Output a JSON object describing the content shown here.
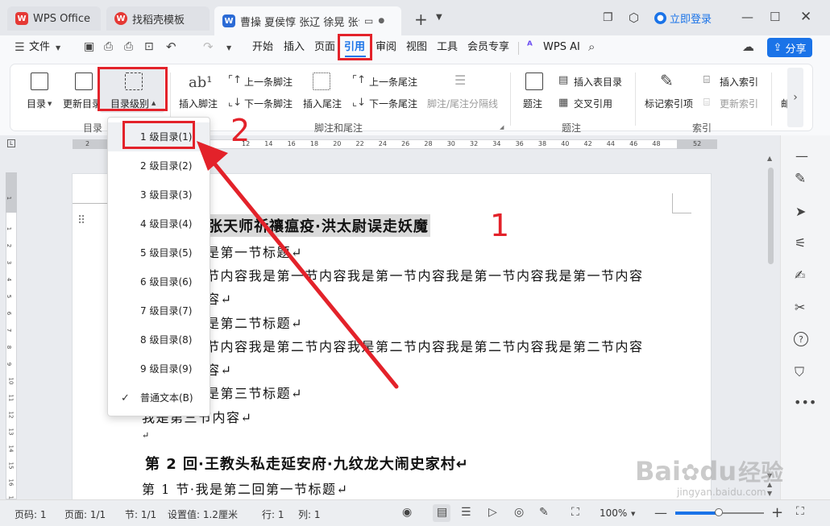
{
  "titlebar": {
    "tabs": [
      {
        "label": "WPS Office",
        "logo": "W"
      },
      {
        "label": "找稻壳模板",
        "logo": "W"
      },
      {
        "label": "曹操 夏侯惇 张辽 徐晃 张郃 于",
        "logo": "W"
      }
    ],
    "login": "立即登录"
  },
  "menubar": {
    "file": "文件",
    "items": [
      "开始",
      "插入",
      "页面",
      "引用",
      "审阅",
      "视图",
      "工具",
      "会员专享"
    ],
    "active": "引用",
    "wps_ai": "WPS AI",
    "share": "分享"
  },
  "ribbon": {
    "toc": "目录",
    "update_toc": "更新目录",
    "toc_level": "目录级别",
    "insert_footnote": "插入脚注",
    "prev_footnote": "上一条脚注",
    "next_footnote": "下一条脚注",
    "insert_endnote": "插入尾注",
    "prev_endnote": "上一条尾注",
    "next_endnote": "下一条尾注",
    "separator_line": "脚注/尾注分隔线",
    "caption": "题注",
    "insert_table_toc": "插入表目录",
    "cross_ref": "交叉引用",
    "mark_index": "标记索引项",
    "insert_index": "插入索引",
    "update_index": "更新索引",
    "more": "邮",
    "groups": {
      "toc": "目录",
      "notes": "脚注和尾注",
      "caption": "题注",
      "index": "索引"
    }
  },
  "ruler": {
    "top_ticks": [
      "2",
      "12",
      "14",
      "16",
      "18",
      "20",
      "22",
      "24",
      "26",
      "28",
      "30",
      "32",
      "34",
      "36",
      "38",
      "40",
      "42",
      "44",
      "46",
      "48",
      "52"
    ],
    "left_ticks": [
      "1",
      "1",
      "2",
      "3",
      "4",
      "5",
      "6",
      "7",
      "8",
      "9",
      "10",
      "11",
      "12",
      "13",
      "14",
      "15",
      "16",
      "17"
    ]
  },
  "document": {
    "lines": [
      {
        "text": "张天师祈禳瘟疫·洪太尉误走妖魔",
        "style": "heading"
      },
      {
        "text": "是第一节标题↵",
        "style": "body"
      },
      {
        "text": "节内容我是第一节内容我是第一节内容我是第一节内容我是第一节内容",
        "style": "body"
      },
      {
        "text": "容↵",
        "style": "body"
      },
      {
        "text": "是第二节标题↵",
        "style": "body"
      },
      {
        "text": "节内容我是第二节内容我是第二节内容我是第二节内容我是第二节内容",
        "style": "body"
      },
      {
        "text": "容↵",
        "style": "body"
      },
      {
        "text": "是第三节标题↵",
        "style": "body"
      },
      {
        "text": "我是第三节内容↵",
        "style": "body"
      },
      {
        "text": "↵",
        "style": "body"
      },
      {
        "text": "第 2 回·王教头私走延安府·九纹龙大闹史家村↵",
        "style": "heading"
      },
      {
        "text": "第 1 节·我是第二回第一节标题↵",
        "style": "body"
      }
    ]
  },
  "dropdown": {
    "items": [
      "1 级目录(1)",
      "2 级目录(2)",
      "3 级目录(3)",
      "4 级目录(4)",
      "5 级目录(5)",
      "6 级目录(6)",
      "7 级目录(7)",
      "8 级目录(8)",
      "9 级目录(9)",
      "普通文本(B)"
    ],
    "checked_index": 9
  },
  "statusbar": {
    "page_no": "页码: 1",
    "pages": "页面: 1/1",
    "section": "节: 1/1",
    "setting": "设置值: 1.2厘米",
    "row": "行: 1",
    "col": "列: 1",
    "zoom": "100%"
  },
  "annotations": {
    "step1": "1",
    "step2": "2",
    "color": "#e3222a"
  },
  "watermark": {
    "brand": "Bai",
    "brand2": "du",
    "cn": "经验",
    "url": "jingyan.baidu.com"
  },
  "colors": {
    "accent": "#1a73e8",
    "red": "#e3222a",
    "wps_red": "#e53935",
    "wps_blue": "#2b6bd6"
  }
}
